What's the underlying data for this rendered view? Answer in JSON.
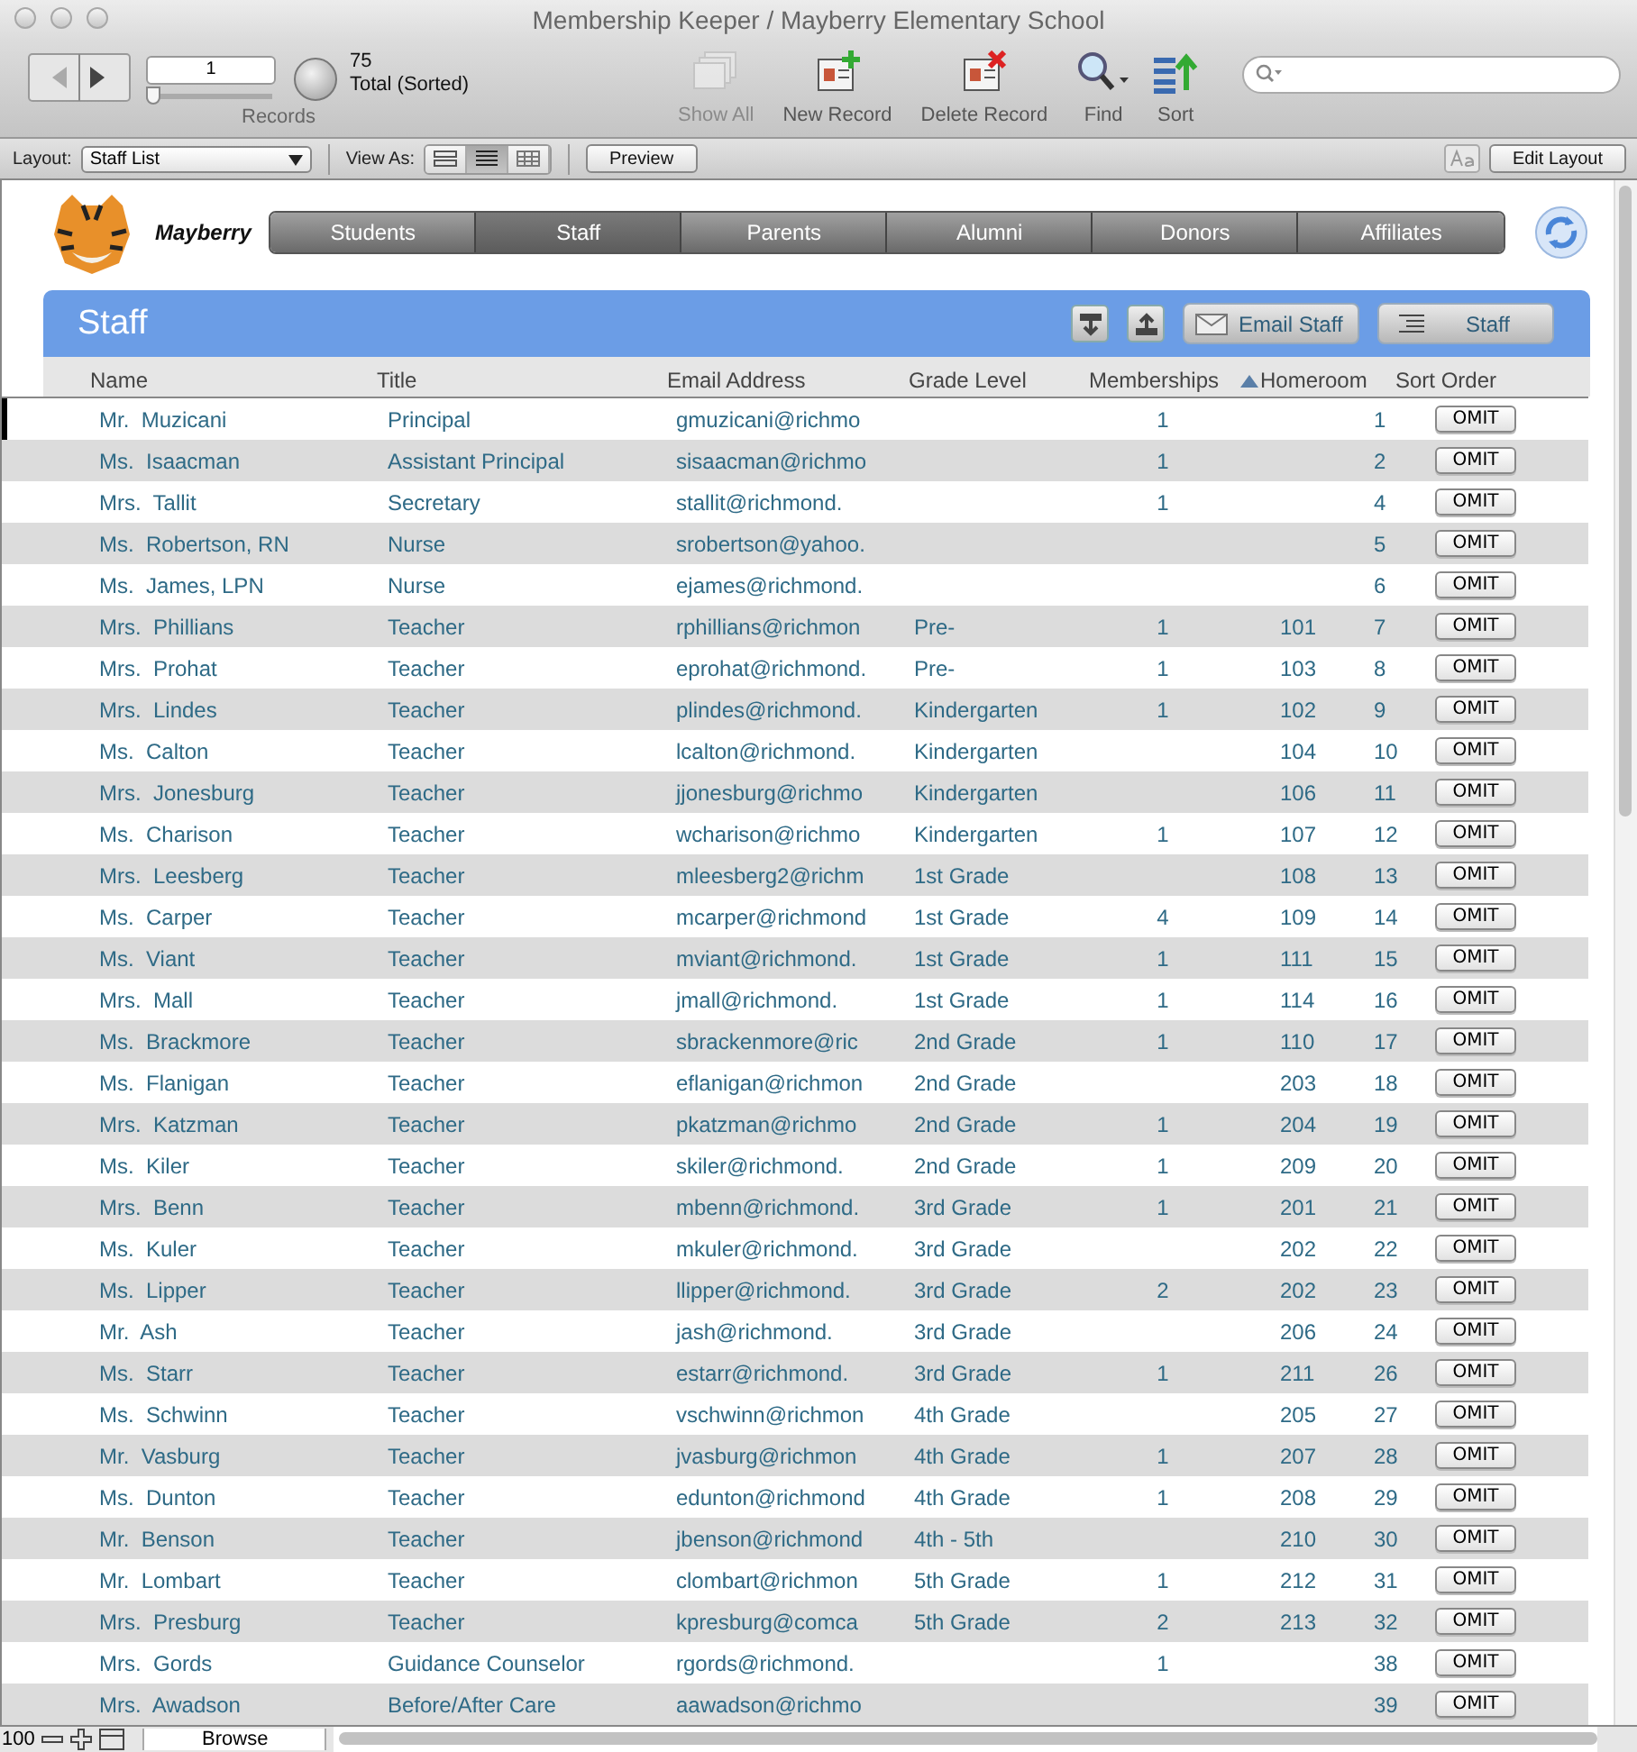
{
  "window": {
    "title": "Membership Keeper / Mayberry Elementary School"
  },
  "toolbar": {
    "record_number": "1",
    "slider": {
      "level": 0
    },
    "found_count": "75",
    "found_status": "Total (Sorted)",
    "records_label": "Records",
    "buttons": [
      {
        "kind": "show-all",
        "label": "Show All",
        "disabled": true
      },
      {
        "kind": "new-record",
        "label": "New Record",
        "disabled": false
      },
      {
        "kind": "delete-record",
        "label": "Delete Record",
        "disabled": false
      },
      {
        "kind": "find",
        "label": "Find",
        "disabled": false
      },
      {
        "kind": "sort",
        "label": "Sort",
        "disabled": false
      }
    ]
  },
  "layout_bar": {
    "layout_label": "Layout:",
    "layout_value": "Staff List",
    "view_as_label": "View As:",
    "view_modes": [
      {
        "kind": "form",
        "selected": false
      },
      {
        "kind": "list",
        "selected": true
      },
      {
        "kind": "table",
        "selected": false
      }
    ],
    "preview": "Preview",
    "edit_layout": "Edit Layout"
  },
  "header": {
    "school": "Mayberry",
    "tabs": [
      {
        "label": "Students",
        "selected": false
      },
      {
        "label": "Staff",
        "selected": true
      },
      {
        "label": "Parents",
        "selected": false
      },
      {
        "label": "Alumni",
        "selected": false
      },
      {
        "label": "Donors",
        "selected": false
      },
      {
        "label": "Affiliates",
        "selected": false
      }
    ]
  },
  "banner": {
    "title": "Staff",
    "email_button": "Email Staff",
    "report_button": "Staff"
  },
  "table": {
    "columns": [
      {
        "label": "Name",
        "sorted": false
      },
      {
        "label": "Title",
        "sorted": false
      },
      {
        "label": "Email Address",
        "sorted": false
      },
      {
        "label": "Grade Level",
        "sorted": false
      },
      {
        "label": "Memberships",
        "sorted": false
      },
      {
        "label": "Homeroom",
        "sorted": true
      },
      {
        "label": "Sort Order",
        "sorted": false
      }
    ],
    "rows": [
      {
        "name": "Mr.  Muzicani",
        "title": "Principal",
        "email": "gmuzicani@richmo",
        "memberships": "1",
        "sort_order": "1",
        "action": "OMIT",
        "selected": true
      },
      {
        "name": "Ms.  Isaacman",
        "title": "Assistant Principal",
        "email": "sisaacman@richmo",
        "memberships": "1",
        "sort_order": "2",
        "action": "OMIT",
        "selected": false
      },
      {
        "name": "Mrs.  Tallit",
        "title": "Secretary",
        "email": "stallit@richmond.",
        "memberships": "1",
        "sort_order": "4",
        "action": "OMIT",
        "selected": false
      },
      {
        "name": "Ms.  Robertson, RN",
        "title": "Nurse",
        "email": "srobertson@yahoo.",
        "sort_order": "5",
        "action": "OMIT",
        "selected": false
      },
      {
        "name": "Ms.  James, LPN",
        "title": "Nurse",
        "email": "ejames@richmond.",
        "sort_order": "6",
        "action": "OMIT",
        "selected": false
      },
      {
        "name": "Mrs.  Phillians",
        "title": "Teacher",
        "email": "rphillians@richmon",
        "grade": "Pre-",
        "memberships": "1",
        "homeroom": "101",
        "sort_order": "7",
        "action": "OMIT",
        "selected": false
      },
      {
        "name": "Mrs.  Prohat",
        "title": "Teacher",
        "email": "eprohat@richmond.",
        "grade": "Pre-",
        "memberships": "1",
        "homeroom": "103",
        "sort_order": "8",
        "action": "OMIT",
        "selected": false
      },
      {
        "name": "Mrs.  Lindes",
        "title": "Teacher",
        "email": "plindes@richmond.",
        "grade": "Kindergarten",
        "memberships": "1",
        "homeroom": "102",
        "sort_order": "9",
        "action": "OMIT",
        "selected": false
      },
      {
        "name": "Ms.  Calton",
        "title": "Teacher",
        "email": "lcalton@richmond.",
        "grade": "Kindergarten",
        "homeroom": "104",
        "sort_order": "10",
        "action": "OMIT",
        "selected": false
      },
      {
        "name": "Mrs.  Jonesburg",
        "title": "Teacher",
        "email": "jjonesburg@richmo",
        "grade": "Kindergarten",
        "homeroom": "106",
        "sort_order": "11",
        "action": "OMIT",
        "selected": false
      },
      {
        "name": "Ms.  Charison",
        "title": "Teacher",
        "email": "wcharison@richmo",
        "grade": "Kindergarten",
        "memberships": "1",
        "homeroom": "107",
        "sort_order": "12",
        "action": "OMIT",
        "selected": false
      },
      {
        "name": "Mrs.  Leesberg",
        "title": "Teacher",
        "email": "mleesberg2@richm",
        "grade": "1st Grade",
        "homeroom": "108",
        "sort_order": "13",
        "action": "OMIT",
        "selected": false
      },
      {
        "name": "Ms.  Carper",
        "title": "Teacher",
        "email": "mcarper@richmond",
        "grade": "1st Grade",
        "memberships": "4",
        "homeroom": "109",
        "sort_order": "14",
        "action": "OMIT",
        "selected": false
      },
      {
        "name": "Ms.  Viant",
        "title": "Teacher",
        "email": "mviant@richmond.",
        "grade": "1st Grade",
        "memberships": "1",
        "homeroom": "111",
        "sort_order": "15",
        "action": "OMIT",
        "selected": false
      },
      {
        "name": "Mrs.  Mall",
        "title": "Teacher",
        "email": "jmall@richmond.",
        "grade": "1st Grade",
        "memberships": "1",
        "homeroom": "114",
        "sort_order": "16",
        "action": "OMIT",
        "selected": false
      },
      {
        "name": "Ms.  Brackmore",
        "title": "Teacher",
        "email": "sbrackenmore@ric",
        "grade": "2nd Grade",
        "memberships": "1",
        "homeroom": "110",
        "sort_order": "17",
        "action": "OMIT",
        "selected": false
      },
      {
        "name": "Ms.  Flanigan",
        "title": "Teacher",
        "email": "eflanigan@richmon",
        "grade": "2nd Grade",
        "homeroom": "203",
        "sort_order": "18",
        "action": "OMIT",
        "selected": false
      },
      {
        "name": "Mrs.  Katzman",
        "title": "Teacher",
        "email": "pkatzman@richmo",
        "grade": "2nd Grade",
        "memberships": "1",
        "homeroom": "204",
        "sort_order": "19",
        "action": "OMIT",
        "selected": false
      },
      {
        "name": "Ms.  Kiler",
        "title": "Teacher",
        "email": "skiler@richmond.",
        "grade": "2nd Grade",
        "memberships": "1",
        "homeroom": "209",
        "sort_order": "20",
        "action": "OMIT",
        "selected": false
      },
      {
        "name": "Mrs.  Benn",
        "title": "Teacher",
        "email": "mbenn@richmond.",
        "grade": "3rd Grade",
        "memberships": "1",
        "homeroom": "201",
        "sort_order": "21",
        "action": "OMIT",
        "selected": false
      },
      {
        "name": "Ms.  Kuler",
        "title": "Teacher",
        "email": "mkuler@richmond.",
        "grade": "3rd Grade",
        "homeroom": "202",
        "sort_order": "22",
        "action": "OMIT",
        "selected": false
      },
      {
        "name": "Ms.  Lipper",
        "title": "Teacher",
        "email": "llipper@richmond.",
        "grade": "3rd Grade",
        "memberships": "2",
        "homeroom": "202",
        "sort_order": "23",
        "action": "OMIT",
        "selected": false
      },
      {
        "name": "Mr.  Ash",
        "title": "Teacher",
        "email": "jash@richmond.",
        "grade": "3rd Grade",
        "homeroom": "206",
        "sort_order": "24",
        "action": "OMIT",
        "selected": false
      },
      {
        "name": "Ms.  Starr",
        "title": "Teacher",
        "email": "estarr@richmond.",
        "grade": "3rd Grade",
        "memberships": "1",
        "homeroom": "211",
        "sort_order": "26",
        "action": "OMIT",
        "selected": false
      },
      {
        "name": "Ms.  Schwinn",
        "title": "Teacher",
        "email": "vschwinn@richmon",
        "grade": "4th Grade",
        "homeroom": "205",
        "sort_order": "27",
        "action": "OMIT",
        "selected": false
      },
      {
        "name": "Mr.  Vasburg",
        "title": "Teacher",
        "email": "jvasburg@richmon",
        "grade": "4th Grade",
        "memberships": "1",
        "homeroom": "207",
        "sort_order": "28",
        "action": "OMIT",
        "selected": false
      },
      {
        "name": "Ms.  Dunton",
        "title": "Teacher",
        "email": "edunton@richmond",
        "grade": "4th Grade",
        "memberships": "1",
        "homeroom": "208",
        "sort_order": "29",
        "action": "OMIT",
        "selected": false
      },
      {
        "name": "Mr.  Benson",
        "title": "Teacher",
        "email": "jbenson@richmond",
        "grade": "4th - 5th",
        "homeroom": "210",
        "sort_order": "30",
        "action": "OMIT",
        "selected": false
      },
      {
        "name": "Mr.  Lombart",
        "title": "Teacher",
        "email": "clombart@richmon",
        "grade": "5th Grade",
        "memberships": "1",
        "homeroom": "212",
        "sort_order": "31",
        "action": "OMIT",
        "selected": false
      },
      {
        "name": "Mrs.  Presburg",
        "title": "Teacher",
        "email": "kpresburg@comca",
        "grade": "5th Grade",
        "memberships": "2",
        "homeroom": "213",
        "sort_order": "32",
        "action": "OMIT",
        "selected": false
      },
      {
        "name": "Mrs.  Gords",
        "title": "Guidance Counselor",
        "email": "rgords@richmond.",
        "memberships": "1",
        "sort_order": "38",
        "action": "OMIT",
        "selected": false
      },
      {
        "name": "Mrs.  Awadson",
        "title": "Before/After Care",
        "email": "aawadson@richmo",
        "sort_order": "39",
        "action": "OMIT",
        "selected": false
      }
    ]
  },
  "status_bar": {
    "zoom": "100",
    "mode": "Browse"
  }
}
